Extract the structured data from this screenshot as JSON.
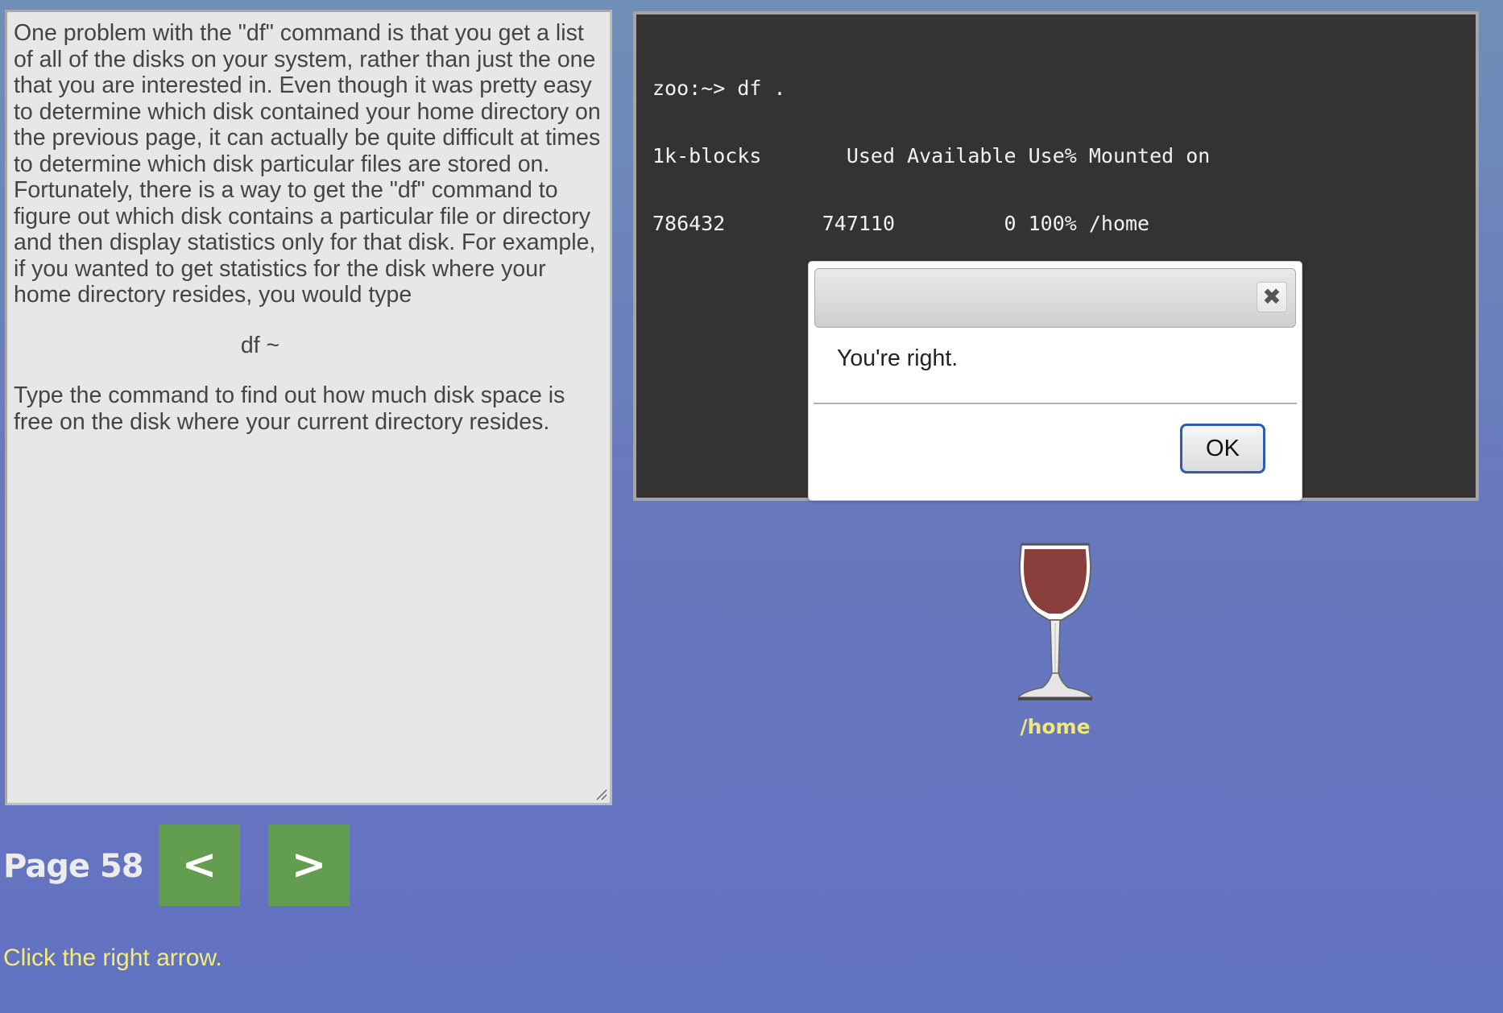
{
  "instructions": {
    "paragraph1": "One problem with the \"df\" command is that you get a list of all of the disks on your system, rather than just the one that you are interested in. Even though it was pretty easy to determine which disk contained your home directory on the previous page, it can actually be quite difficult at times to determine which disk particular files are stored on. Fortunately, there is a way to get the \"df\" command to figure out which disk contains a particular file or directory and then display statistics only for that disk. For example, if you wanted to get statistics for the disk where your home directory resides, you would type",
    "command": "df ~",
    "paragraph2": "Type the command to find out how much disk space is free on the disk where your current directory resides."
  },
  "terminal": {
    "lines": [
      "zoo:~> df .",
      "1k-blocks       Used Available Use% Mounted on",
      "786432        747110         0 100% /home"
    ]
  },
  "dialog": {
    "title": "",
    "close_icon": "close-icon",
    "message": "You're right.",
    "ok_label": "OK"
  },
  "disk": {
    "icon": "wine-glass-icon",
    "fill_color": "#8a3f3c",
    "label": "/home"
  },
  "navigation": {
    "page_label": "Page 58",
    "prev_label": "<",
    "next_label": ">",
    "button_color": "#639e50"
  },
  "hint": "Click the right arrow."
}
